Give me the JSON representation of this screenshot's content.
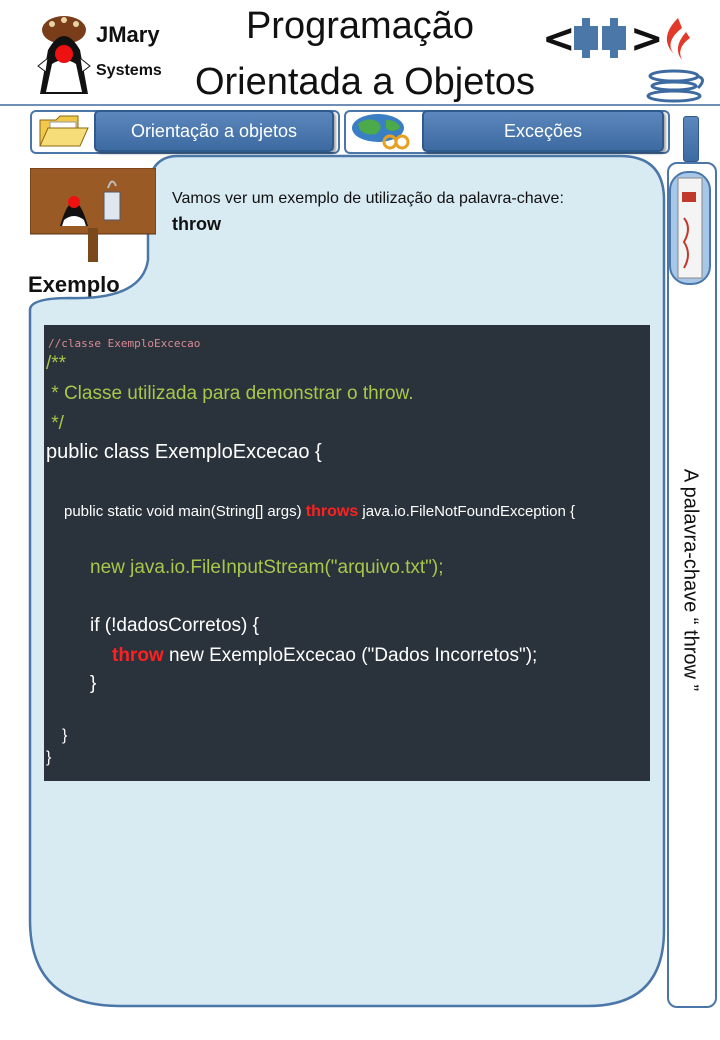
{
  "header": {
    "brand_line1": "JMary",
    "brand_line2": "Systems",
    "title_line1": "Programação",
    "title_line2": "Orientada a Objetos",
    "cpp_text": "<++>"
  },
  "nav": {
    "left_label": "Orientação a objetos",
    "right_label": "Exceções"
  },
  "content": {
    "section_label": "Exemplo",
    "intro_text": "Vamos ver um exemplo de utilização da palavra-chave:",
    "keyword": "throw"
  },
  "side": {
    "vertical_title": "A palavra-chave “ throw ”"
  },
  "code": {
    "file_comment": "//classe ExemploExcecao",
    "doc_open": "/**",
    "doc_body": " * Classe utilizada para demonstrar o throw.",
    "doc_close": " */",
    "class_decl": "public class ExemploExcecao {",
    "method_pre": "public static void main(String[] args) ",
    "method_kw": "throws",
    "method_post": " java.io.FileNotFoundException {",
    "stream_line": "new java.io.FileInputStream(\"arquivo.txt\");",
    "if_line": "if (!dadosCorretos) {",
    "throw_kw": "throw",
    "throw_rest": " new ExemploExcecao (\"Dados Incorretos\");",
    "close_if": "}",
    "close_method": "}",
    "close_class": "}"
  },
  "colors": {
    "accent": "#4a76a8",
    "panel_bg": "#d8eaf2",
    "code_bg": "#2a323b",
    "keyword_red": "#ff2020",
    "comment_green": "#a6c84a"
  }
}
